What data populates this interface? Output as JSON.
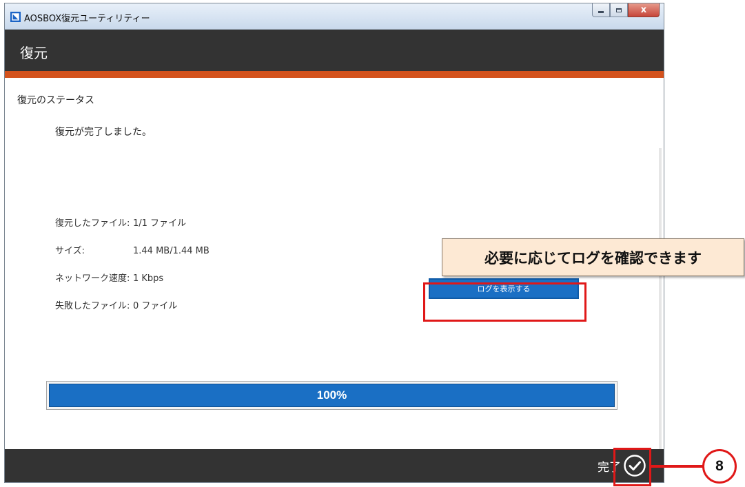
{
  "window": {
    "title": "AOSBOX復元ユーティリティー",
    "buttons": {
      "minimize_icon": "minimize-icon",
      "maximize_icon": "maximize-icon",
      "close_label": "x"
    }
  },
  "header": {
    "title": "復元"
  },
  "status": {
    "section_title": "復元のステータス",
    "message": "復元が完了しました。",
    "rows": [
      {
        "label": "復元したファイル:",
        "value": "1/1 ファイル"
      },
      {
        "label": "サイズ:",
        "value": "1.44 MB/1.44 MB"
      },
      {
        "label": "ネットワーク速度:",
        "value": "1 Kbps"
      },
      {
        "label": "失敗したファイル:",
        "value": "0 ファイル"
      }
    ],
    "log_button_label": "ログを表示する"
  },
  "progress": {
    "value": 1.0,
    "label": "100%"
  },
  "footer": {
    "done_label": "完了",
    "done_icon": "check-circle-icon"
  },
  "annotations": {
    "callout_text": "必要に応じてログを確認できます",
    "step_number": "8",
    "highlight_color": "#e01818"
  },
  "colors": {
    "header_bg": "#333333",
    "accent": "#d4521c",
    "primary_blue": "#1a6fc4"
  }
}
